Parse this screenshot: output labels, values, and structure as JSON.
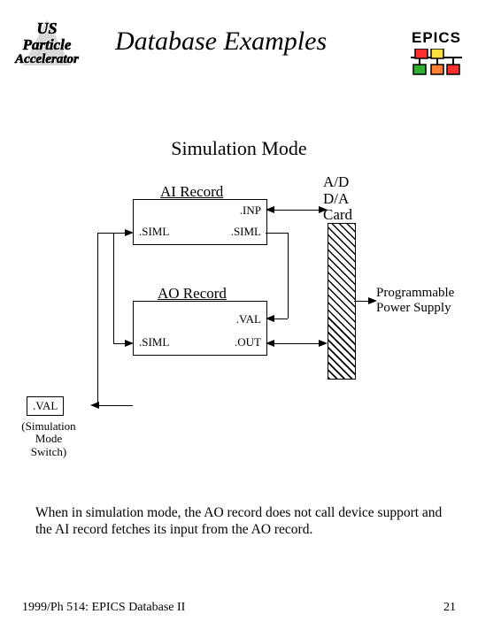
{
  "header": {
    "us_logo": {
      "line1": "US",
      "line2": "Particle",
      "line3": "Accelerator"
    },
    "title": "Database Examples",
    "epics": "EPICS",
    "epics_colors": {
      "a": "#ff3030",
      "b": "#ffe040",
      "c": "#30b030",
      "d": "#ff8030",
      "line": "#000"
    }
  },
  "subtitle": "Simulation Mode",
  "diagram": {
    "ai": {
      "title": "AI Record",
      "inp": ".INP",
      "siml_in": ".SIML",
      "siml_out": ".SIML"
    },
    "ao": {
      "title": "AO Record",
      "val": ".VAL",
      "siml": ".SIML",
      "out": ".OUT"
    },
    "switch": {
      "val": ".VAL",
      "caption1": "(Simulation",
      "caption2": "Mode",
      "caption3": "Switch)"
    },
    "adda": {
      "l1": "A/D",
      "l2": "D/A",
      "l3": "Card"
    },
    "pps": {
      "l1": "Programmable",
      "l2": "Power Supply"
    }
  },
  "bodytext": "When in simulation mode, the AO record does not call device support and the AI record fetches its input from the AO record.",
  "footer": {
    "left": "1999/Ph 514: EPICS Database II",
    "page": "21"
  }
}
